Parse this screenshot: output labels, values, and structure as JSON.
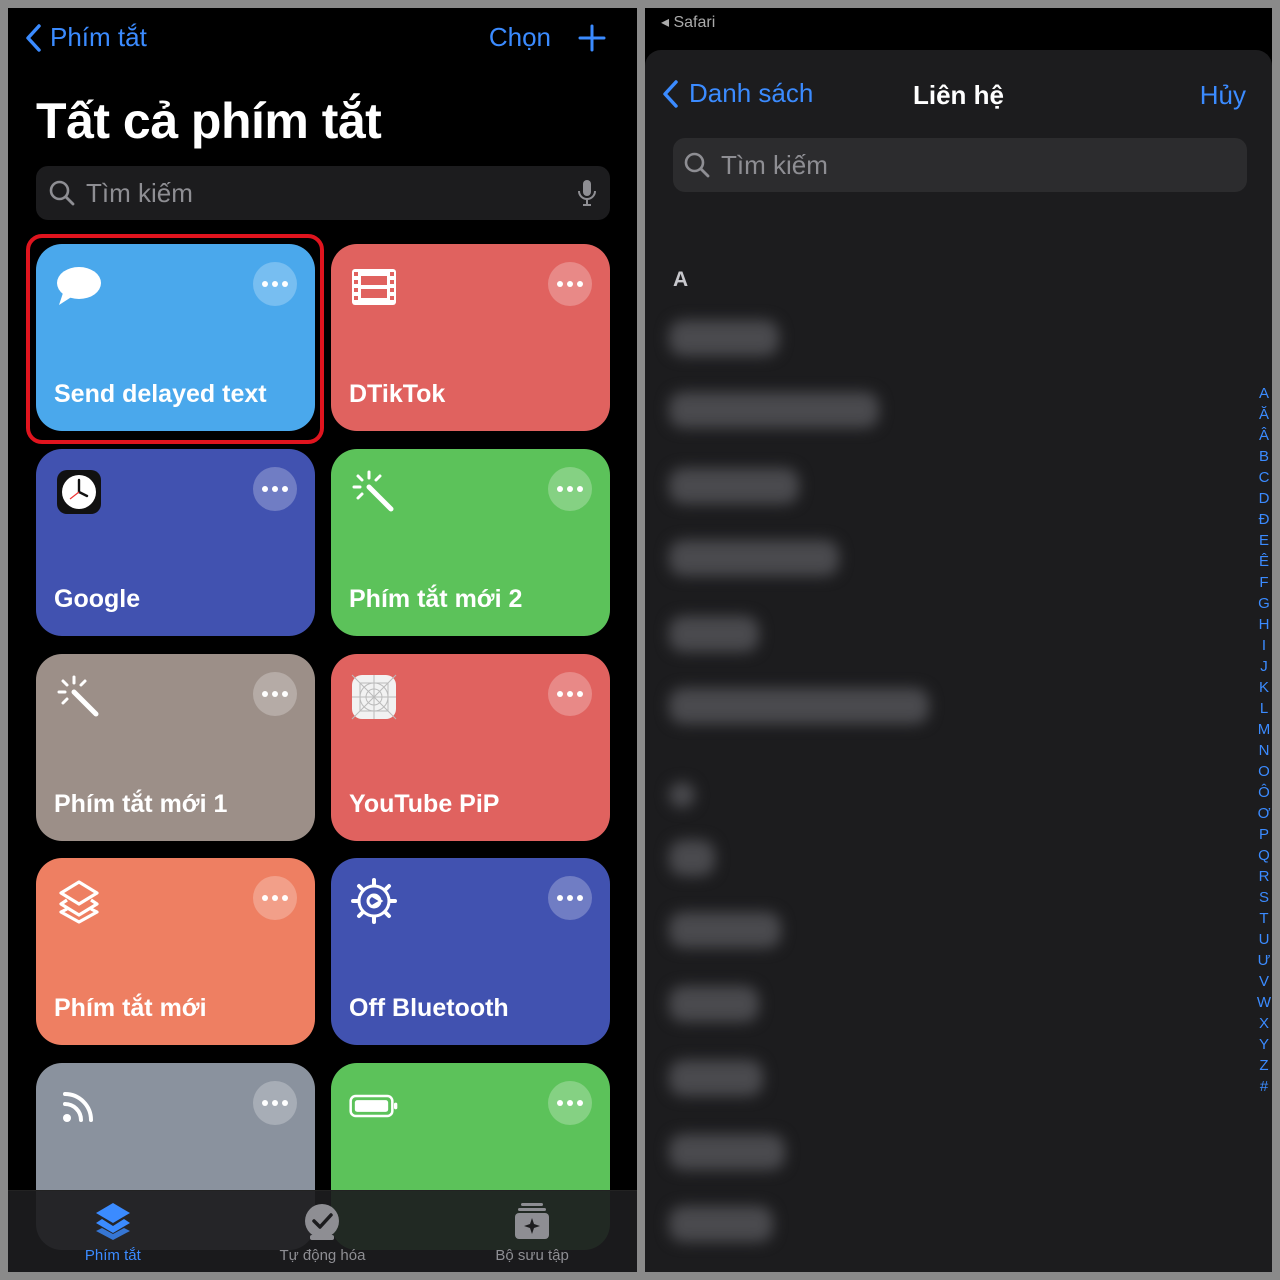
{
  "left": {
    "nav": {
      "back_label": "Phím tắt",
      "select_label": "Chọn"
    },
    "title": "Tất cả phím tắt",
    "search": {
      "placeholder": "Tìm kiếm"
    },
    "tiles": [
      {
        "label": "Send delayed text",
        "color": "#4aa8ec",
        "icon": "message-bubble-icon",
        "highlighted": true
      },
      {
        "label": "DTikTok",
        "color": "#e0625f",
        "icon": "film-strip-icon"
      },
      {
        "label": "Google",
        "color": "#4152b0",
        "icon": "clock-icon"
      },
      {
        "label": "Phím tắt mới 2",
        "color": "#5cc25a",
        "icon": "magic-wand-icon"
      },
      {
        "label": "Phím tắt mới 1",
        "color": "#9c8f88",
        "icon": "magic-wand-icon"
      },
      {
        "label": "YouTube PiP",
        "color": "#e0625f",
        "icon": "app-grid-icon"
      },
      {
        "label": "Phím tắt mới",
        "color": "#ee7f62",
        "icon": "layers-icon"
      },
      {
        "label": "Off Bluetooth",
        "color": "#4152b0",
        "icon": "settings-gear-icon"
      },
      {
        "label": "",
        "color": "#8a929e",
        "icon": "rss-feed-icon"
      },
      {
        "label": "",
        "color": "#5cc25a",
        "icon": "battery-icon"
      }
    ],
    "tabbar": [
      {
        "label": "Phím tắt",
        "icon": "shortcuts-layers-icon",
        "active": true
      },
      {
        "label": "Tự động hóa",
        "icon": "automation-check-icon",
        "active": false
      },
      {
        "label": "Bộ sưu tập",
        "icon": "gallery-icon",
        "active": false
      }
    ]
  },
  "right": {
    "status": {
      "back_app": "◂ Safari"
    },
    "nav": {
      "back_label": "Danh sách",
      "title": "Liên hệ",
      "cancel_label": "Hủy"
    },
    "search": {
      "placeholder": "Tìm kiếm"
    },
    "sections": [
      {
        "header": "A"
      }
    ],
    "index_letters": [
      "A",
      "Ă",
      "Â",
      "B",
      "C",
      "D",
      "Đ",
      "E",
      "Ê",
      "F",
      "G",
      "H",
      "I",
      "J",
      "K",
      "L",
      "M",
      "N",
      "O",
      "Ô",
      "Ơ",
      "P",
      "Q",
      "R",
      "S",
      "T",
      "U",
      "Ư",
      "V",
      "W",
      "X",
      "Y",
      "Z",
      "#"
    ]
  }
}
